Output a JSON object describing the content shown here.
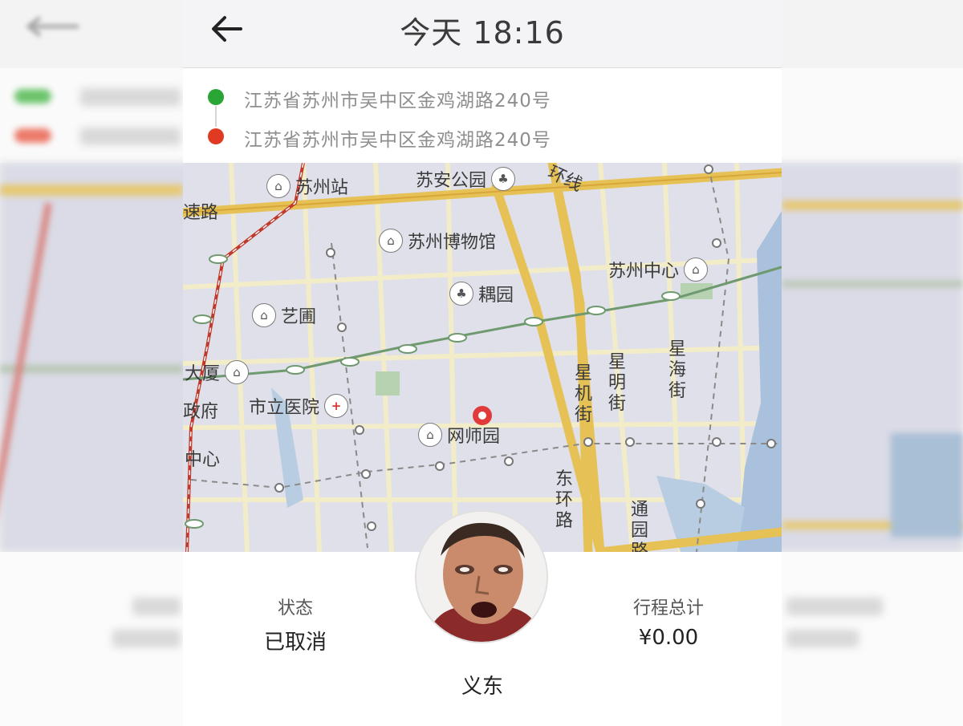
{
  "header": {
    "title": "今天 18:16",
    "back_icon": "arrow-left-icon"
  },
  "addresses": {
    "start": {
      "text": "江苏省苏州市吴中区金鸡湖路240号",
      "color": "#2aa636"
    },
    "end": {
      "text": "江苏省苏州市吴中区金鸡湖路240号",
      "color": "#e03a22"
    }
  },
  "map": {
    "pois": [
      {
        "label": "苏州站",
        "icon": "station-icon"
      },
      {
        "label": "苏安公园",
        "icon": "park-icon"
      },
      {
        "label": "苏州博物馆",
        "icon": "museum-icon"
      },
      {
        "label": "苏州中心",
        "icon": "landmark-icon"
      },
      {
        "label": "耦园",
        "icon": "garden-icon"
      },
      {
        "label": "艺圃",
        "icon": "garden-icon"
      },
      {
        "label": "大厦",
        "icon": "building-icon"
      },
      {
        "label": "市立医院",
        "icon": "hospital-icon"
      },
      {
        "label": "网师园",
        "icon": "garden-icon"
      },
      {
        "label": "政府",
        "icon": ""
      },
      {
        "label": "中心",
        "icon": ""
      },
      {
        "label": "速路",
        "icon": ""
      },
      {
        "label": "环线",
        "icon": ""
      }
    ],
    "streets": [
      "星机街",
      "星明街",
      "星海街",
      "东环路",
      "通园路"
    ],
    "destination_marker": "location-pin-icon"
  },
  "trip": {
    "status_label": "状态",
    "status_value": "已取消",
    "total_label": "行程总计",
    "total_value": "¥0.00",
    "driver_name": "义东",
    "avatar_icon": "driver-avatar"
  },
  "colors": {
    "header_bg": "#f4f4f6",
    "map_bg": "#dfe0e9",
    "road": "#e8c86a",
    "metro": "#6f9a6f",
    "railway": "#c0392b"
  }
}
